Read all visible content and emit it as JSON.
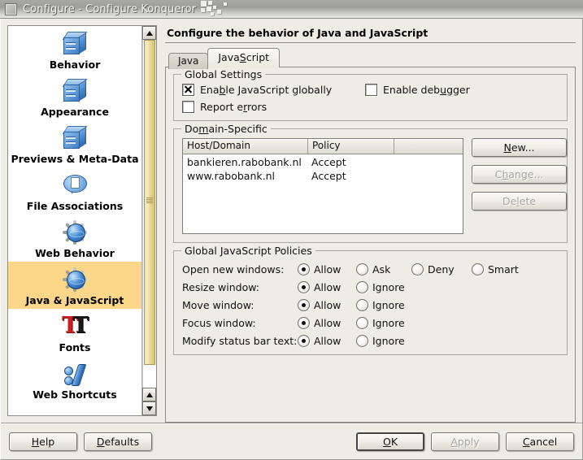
{
  "window": {
    "title": "Configure - Configure Konqueror",
    "icon": "window-menu-icon"
  },
  "sidebar": {
    "items": [
      {
        "label": "Behavior",
        "icon": "cube-icon",
        "selected": false
      },
      {
        "label": "Appearance",
        "icon": "cube-icon",
        "selected": false
      },
      {
        "label": "Previews & Meta-Data",
        "icon": "cube-icon",
        "selected": false
      },
      {
        "label": "File Associations",
        "icon": "speech-bubble-icon",
        "selected": false
      },
      {
        "label": "Web Behavior",
        "icon": "globe-gear-icon",
        "selected": false
      },
      {
        "label": "Java & JavaScript",
        "icon": "globe-gear-icon",
        "selected": true
      },
      {
        "label": "Fonts",
        "icon": "fonts-icon",
        "selected": false
      },
      {
        "label": "Web Shortcuts",
        "icon": "web-shortcuts-icon",
        "selected": false
      }
    ],
    "scrollbar": {
      "up_arrow": "scroll-up-icon",
      "down_arrow": "scroll-down-icon"
    },
    "selected_color": "#fcd78a"
  },
  "pane": {
    "title": "Configure the behavior of Java and JavaScript",
    "tabs": [
      {
        "label": "Java",
        "accel": "J",
        "active": false
      },
      {
        "label": "JavaScript",
        "accel": "S",
        "active": true
      }
    ]
  },
  "global_settings": {
    "legend": "Global Settings",
    "checkboxes": [
      {
        "label": "Enable JavaScript globally",
        "checked": true,
        "name": "enable-javascript-globally"
      },
      {
        "label": "Enable debugger",
        "checked": false,
        "name": "enable-debugger"
      },
      {
        "label": "Report errors",
        "checked": false,
        "name": "report-errors"
      }
    ]
  },
  "domain_specific": {
    "legend": "Domain-Specific",
    "columns": [
      "Host/Domain",
      "Policy",
      ""
    ],
    "rows": [
      {
        "host": "bankieren.rabobank.nl",
        "policy": "Accept"
      },
      {
        "host": "www.rabobank.nl",
        "policy": "Accept"
      }
    ],
    "buttons": [
      {
        "label": "New...",
        "enabled": true
      },
      {
        "label": "Change...",
        "enabled": false
      },
      {
        "label": "Delete",
        "enabled": false
      }
    ]
  },
  "global_policies": {
    "legend": "Global JavaScript Policies",
    "rows": [
      {
        "label": "Open new windows:",
        "options": [
          {
            "label": "Allow",
            "selected": true
          },
          {
            "label": "Ask",
            "selected": false
          },
          {
            "label": "Deny",
            "selected": false
          },
          {
            "label": "Smart",
            "selected": false
          }
        ]
      },
      {
        "label": "Resize window:",
        "options": [
          {
            "label": "Allow",
            "selected": true
          },
          {
            "label": "Ignore",
            "selected": false
          }
        ]
      },
      {
        "label": "Move window:",
        "options": [
          {
            "label": "Allow",
            "selected": true
          },
          {
            "label": "Ignore",
            "selected": false
          }
        ]
      },
      {
        "label": "Focus window:",
        "options": [
          {
            "label": "Allow",
            "selected": true
          },
          {
            "label": "Ignore",
            "selected": false
          }
        ]
      },
      {
        "label": "Modify status bar text:",
        "options": [
          {
            "label": "Allow",
            "selected": true
          },
          {
            "label": "Ignore",
            "selected": false
          }
        ]
      }
    ]
  },
  "footer": {
    "buttons": [
      {
        "label": "Help",
        "accel": "H",
        "enabled": true,
        "default": false
      },
      {
        "label": "Defaults",
        "accel": "D",
        "enabled": true,
        "default": false
      },
      {
        "label": "OK",
        "accel": "O",
        "enabled": true,
        "default": true
      },
      {
        "label": "Apply",
        "accel": "A",
        "enabled": false,
        "default": false
      },
      {
        "label": "Cancel",
        "accel": "C",
        "enabled": true,
        "default": false
      }
    ]
  }
}
